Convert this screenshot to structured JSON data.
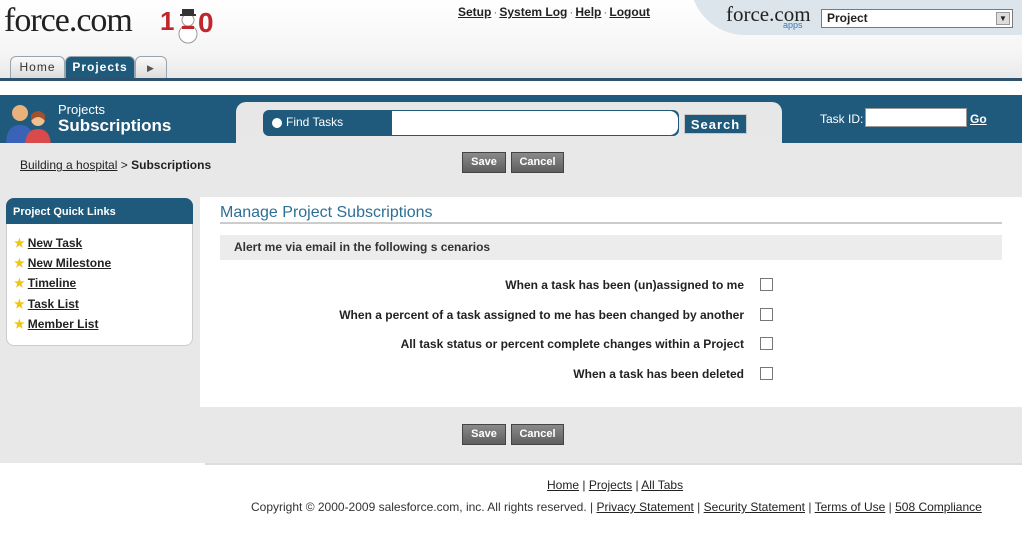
{
  "header": {
    "logo_text": "force.com",
    "top_links": [
      "Setup",
      "System Log",
      "Help",
      "Logout"
    ],
    "apps_logo": "force.com",
    "apps_sub": "apps",
    "app_selector_value": "Project"
  },
  "tabs": [
    {
      "label": "Home",
      "active": false
    },
    {
      "label": "Projects",
      "active": true
    }
  ],
  "banner": {
    "subtitle": "Projects",
    "title": "Subscriptions",
    "find_label": "Find Tasks",
    "search_button": "Search",
    "taskid_label": "Task ID:",
    "go_label": "Go"
  },
  "breadcrumb": {
    "parent": "Building a hospital",
    "separator": ">",
    "current": "Subscriptions"
  },
  "buttons": {
    "save": "Save",
    "cancel": "Cancel"
  },
  "quick_links": {
    "title": "Project Quick Links",
    "items": [
      "New Task",
      "New Milestone",
      "Timeline",
      "Task List",
      "Member List"
    ]
  },
  "main": {
    "title": "Manage Project Subscriptions",
    "alert_heading": "Alert me via email in the following s cenarios",
    "options": [
      {
        "label": "When a task has been (un)assigned to me",
        "checked": false
      },
      {
        "label": "When a percent of a task assigned to me has been changed by another",
        "checked": false
      },
      {
        "label": "All task status or percent complete changes within a Project",
        "checked": false
      },
      {
        "label": "When a task has been deleted",
        "checked": false
      }
    ]
  },
  "footer": {
    "links": [
      "Home",
      "Projects",
      "All Tabs"
    ],
    "copyright": "Copyright © 2000-2009 salesforce.com, inc. All rights reserved. |",
    "legal_links": [
      "Privacy Statement",
      "Security Statement",
      "Terms of Use",
      "508 Compliance"
    ]
  },
  "colors": {
    "brand_blue": "#1f5a7c",
    "title_blue": "#2d6f95",
    "star": "#f1c40f"
  }
}
